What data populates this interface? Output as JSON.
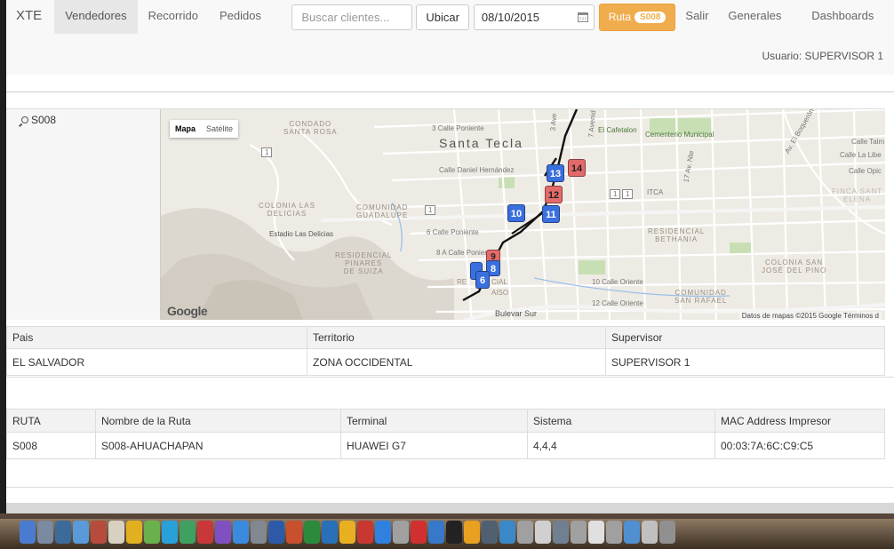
{
  "nav": {
    "brand": "XTE",
    "vendedores": "Vendedores",
    "recorrido": "Recorrido",
    "pedidos": "Pedidos",
    "search_placeholder": "Buscar clientes...",
    "ubicar": "Ubicar",
    "date": "08/10/2015",
    "ruta_label": "Ruta",
    "ruta_badge": "S008",
    "salir": "Salir",
    "generales": "Generales",
    "dashboards": "Dashboards"
  },
  "user": {
    "label": "Usuario: SUPERVISOR 1"
  },
  "route_panel": {
    "route": "S008"
  },
  "map": {
    "type_map": "Mapa",
    "type_satellite": "Satélite",
    "google": "Google",
    "attribution": "Datos de mapas ©2015 Google   Términos d",
    "labels": {
      "condado": "CONDADO",
      "santa_rosa": "SANTA ROSA",
      "calle3": "3 Calle Poniente",
      "santa_tecla": "Santa Tecla",
      "cafetalon": "El Cafetalon",
      "cementerio": "Cementerio Municipal",
      "daniel": "Calle Daniel Hernández",
      "colonia_las": "COLONIA LAS",
      "delicias": "DELICIAS",
      "comunidad": "COMUNIDAD",
      "guadalupe": "GUADALUPE",
      "estadio": "Estadio Las Delicias",
      "calle6": "6 Calle Poniente",
      "calle8a": "8 A Calle Ponien",
      "residencial1": "RESIDENCIAL",
      "pinares": "PINARES",
      "de_suiza": "DE SUIZA",
      "residencial2": "RESIDENCIAL",
      "bethania": "BETHANIA",
      "itca": "ITCA",
      "calle10": "10 Calle Oriente",
      "calle12": "12 Calle Oriente",
      "comunidad2": "COMUNIDAD",
      "san_rafael": "SAN RAFAEL",
      "colonia_san": "COLONIA SAN",
      "jose_pino": "JOSÉ DEL PINO",
      "bulevar": "Bulevar Sur",
      "calle_talm": "Calle Talm",
      "calle_libe": "Calle La Libe",
      "calle_opic": "Calle Opic",
      "finca": "FINCA SANT",
      "elena": "ELENA",
      "boqueron": "Av. El Boquerón",
      "av17": "17 Av. Nte",
      "av3": "3 Ave",
      "av7": "7 Avenid",
      "residencial3": "RE",
      "aiso": "AISO",
      "cial": "CIAL",
      "num1": "1",
      "num2": "1",
      "num3": "1",
      "num4": "1"
    },
    "markers": [
      {
        "num": "14",
        "color": "red"
      },
      {
        "num": "13",
        "color": "blue"
      },
      {
        "num": "12",
        "color": "red"
      },
      {
        "num": "11",
        "color": "blue"
      },
      {
        "num": "10",
        "color": "blue"
      },
      {
        "num": "9",
        "color": "red"
      },
      {
        "num": "8",
        "color": "blue"
      },
      {
        "num": "7",
        "color": "blue"
      },
      {
        "num": "6",
        "color": "blue"
      }
    ]
  },
  "table1": {
    "headers": [
      "Pais",
      "Territorio",
      "Supervisor"
    ],
    "row": [
      "EL SALVADOR",
      "ZONA OCCIDENTAL",
      "SUPERVISOR 1"
    ]
  },
  "table2": {
    "headers": [
      "RUTA",
      "Nombre de la Ruta",
      "Terminal",
      "Sistema",
      "MAC Address Impresor"
    ],
    "row": [
      "S008",
      "S008-AHUACHAPAN",
      "HUAWEI G7",
      "4,4,4",
      "00:03:7A:6C:C9:C5"
    ]
  },
  "colors": {
    "accent": "#f0ad4e",
    "marker_blue": "#3a6fde",
    "marker_red": "#e46a6a"
  },
  "dock": {
    "icons": [
      "finder-icon",
      "safari-icon",
      "mail-icon",
      "contacts-icon",
      "calendar-icon",
      "notes-icon",
      "reminders-icon",
      "maps-icon",
      "messages-icon",
      "facetime-icon",
      "photobooth-icon",
      "itunes-icon",
      "appstore-icon",
      "preferences-icon",
      "word-icon",
      "powerpoint-icon",
      "excel-icon",
      "outlook-icon",
      "chrome-icon",
      "filezilla-icon",
      "dropbox-icon",
      "question-icon",
      "opera-icon",
      "xcode-icon",
      "terminal-icon",
      "chrome2-icon",
      "monitor-icon",
      "network-icon",
      "question2-icon",
      "calculator-icon",
      "tools-icon",
      "question3-icon",
      "textedit-icon",
      "question4-icon",
      "finder2-icon",
      "mail2-icon",
      "trash-icon"
    ]
  }
}
